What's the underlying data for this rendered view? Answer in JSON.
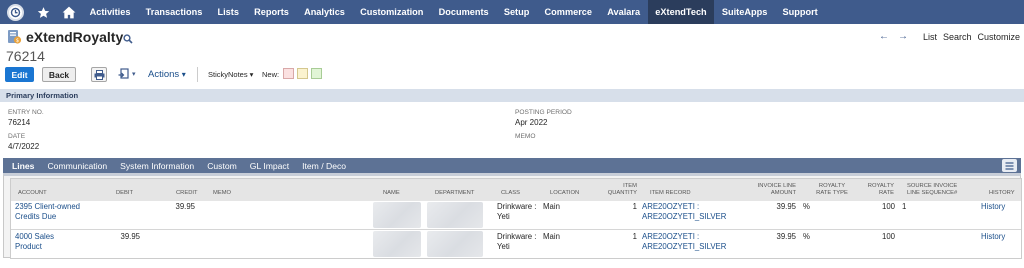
{
  "nav": {
    "items": [
      {
        "label": "Activities",
        "active": false
      },
      {
        "label": "Transactions",
        "active": false
      },
      {
        "label": "Lists",
        "active": false
      },
      {
        "label": "Reports",
        "active": false
      },
      {
        "label": "Analytics",
        "active": false
      },
      {
        "label": "Customization",
        "active": false
      },
      {
        "label": "Documents",
        "active": false
      },
      {
        "label": "Setup",
        "active": false
      },
      {
        "label": "Commerce",
        "active": false
      },
      {
        "label": "Avalara",
        "active": false
      },
      {
        "label": "eXtendTech",
        "active": true
      },
      {
        "label": "SuiteApps",
        "active": false
      },
      {
        "label": "Support",
        "active": false
      }
    ],
    "icons": [
      "recent-records-icon",
      "star-icon",
      "home-icon"
    ],
    "bg_color": "#3f5b8c"
  },
  "record": {
    "title": "eXtendRoyalty",
    "number": "76214",
    "nav_links": {
      "list": "List",
      "search": "Search",
      "customize": "Customize"
    }
  },
  "toolbar": {
    "edit": "Edit",
    "back": "Back",
    "actions": "Actions",
    "actions_caret": "▾",
    "sticky_notes": "StickyNotes ▾",
    "new_label": "New:",
    "edit_color": "#1a76d2"
  },
  "primary": {
    "heading": "Primary Information",
    "fields": [
      {
        "label": "ENTRY NO.",
        "value": "76214"
      },
      {
        "label": "DATE",
        "value": "4/7/2022"
      },
      {
        "label": "POSTING PERIOD",
        "value": "Apr 2022"
      },
      {
        "label": "MEMO",
        "value": ""
      }
    ]
  },
  "tabs": [
    {
      "label": "Lines",
      "active": true
    },
    {
      "label": "Communication",
      "active": false
    },
    {
      "label": "System Information",
      "active": false
    },
    {
      "label": "Custom",
      "active": false
    },
    {
      "label": "GL Impact",
      "active": false
    },
    {
      "label": "Item / Deco",
      "active": false
    }
  ],
  "lines": {
    "columns": [
      "ACCOUNT",
      "DEBIT",
      "CREDIT",
      "MEMO",
      "NAME",
      "DEPARTMENT",
      "CLASS",
      "LOCATION",
      "ITEM QUANTITY",
      "ITEM RECORD",
      "INVOICE LINE AMOUNT",
      "ROYALTY RATE TYPE",
      "ROYALTY RATE",
      "SOURCE INVOICE LINE SEQUENCE#",
      "HISTORY"
    ],
    "rows": [
      {
        "account": "2395 Client-owned Credits Due",
        "debit": "",
        "credit": "39.95",
        "memo": "",
        "class": "Drinkware : Yeti",
        "location": "Main",
        "item_quantity": "1",
        "item_record": "ARE20OZYETI : ARE20OZYETI_SILVER",
        "invoice_line_amount": "39.95",
        "royalty_rate_type": "%",
        "royalty_rate": "100",
        "source_seq": "1",
        "history": "History"
      },
      {
        "account": "4000 Sales Product",
        "debit": "39.95",
        "credit": "",
        "memo": "",
        "class": "Drinkware : Yeti",
        "location": "Main",
        "item_quantity": "1",
        "item_record": "ARE20OZYETI : ARE20OZYETI_SILVER",
        "invoice_line_amount": "39.95",
        "royalty_rate_type": "%",
        "royalty_rate": "100",
        "source_seq": "",
        "history": "History"
      }
    ]
  }
}
